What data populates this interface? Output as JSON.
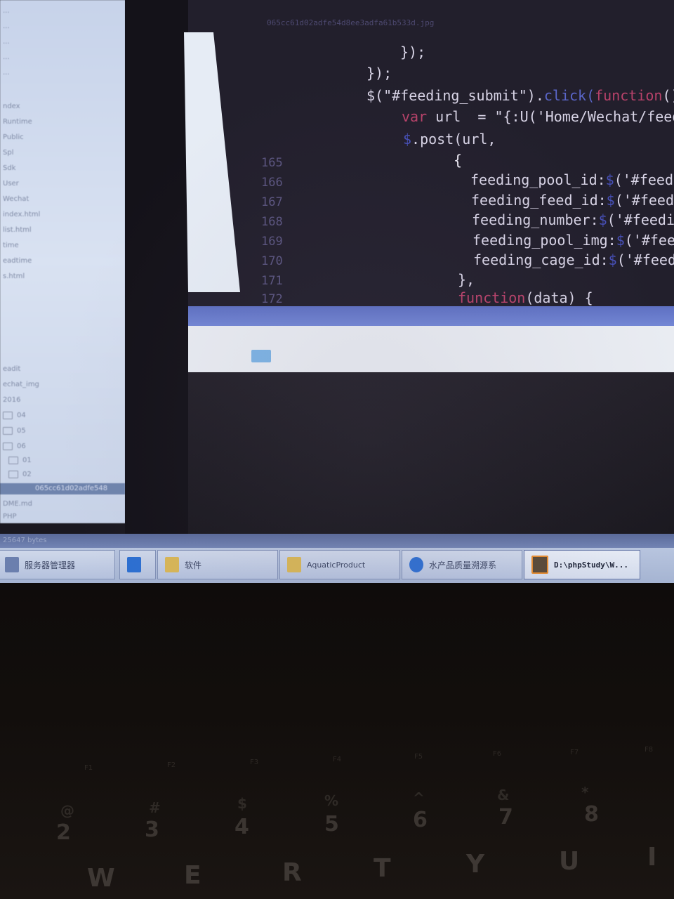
{
  "editor": {
    "tab_title": "065cc61d02adfe54d8ee3adfa61b533d.jpg",
    "gutter": [
      "165",
      "166",
      "167",
      "168",
      "169",
      "170",
      "171",
      "172"
    ],
    "lines": [
      {
        "text": "});"
      },
      {
        "text": "});"
      },
      {
        "prefix": "$(\"#feeding_submit\").",
        "call": "click",
        "open": "(",
        "kw": "function",
        "rest": "()"
      },
      {
        "kw": "var",
        "rest": " url  = \"{:U('Home/Wechat/feedi"
      },
      {
        "dollar": "$",
        "rest": ".post(url,"
      },
      {
        "text": "{"
      },
      {
        "key": "feeding_pool_id:",
        "dollar": "$",
        "rest": "('#feedi"
      },
      {
        "key": "feeding_feed_id:",
        "dollar": "$",
        "rest": "('#feedi"
      },
      {
        "key": "feeding_number:",
        "dollar": "$",
        "rest": "('#feeding"
      },
      {
        "key": "feeding_pool_img:",
        "dollar": "$",
        "rest": "('#feedi"
      },
      {
        "key": "feeding_cage_id:",
        "dollar": "$",
        "rest": "('#feedir"
      },
      {
        "text": "},"
      },
      {
        "kw": "function",
        "rest": "(data) {"
      }
    ]
  },
  "explorer": {
    "items": [
      "...",
      "...",
      "...",
      "...",
      "...",
      "ndex",
      "Runtime",
      "Public",
      "Spl",
      "Sdk",
      "User",
      "Wechat",
      "index.html",
      "list.html",
      "time",
      "eadtime",
      "s.html"
    ],
    "tree": [
      "eadit",
      "echat_img",
      "2016",
      "04",
      "05",
      "06",
      "01",
      "02"
    ],
    "selected_file": "065cc61d02adfe548",
    "bottom_items": [
      "DME.md",
      "PHP"
    ]
  },
  "status": {
    "text": "25647 bytes"
  },
  "taskbar": {
    "tasks": [
      {
        "label": "服务器管理器",
        "icon": "server-manager-icon"
      },
      {
        "label": "",
        "icon": "powershell-icon"
      },
      {
        "label": "软件",
        "icon": "folder-icon"
      },
      {
        "label": "AquaticProduct",
        "icon": "folder-icon"
      },
      {
        "label": "水产品质量溯源系",
        "icon": "sogou-icon"
      },
      {
        "label": "D:\\phpStudy\\W...",
        "icon": "sublime-icon"
      }
    ]
  },
  "keyboard": {
    "function_keys": [
      "F1",
      "F2",
      "F3",
      "F4",
      "F5",
      "F6",
      "F7",
      "F8"
    ],
    "number_keys": [
      "2",
      "3",
      "4",
      "5",
      "6",
      "7",
      "8"
    ],
    "symbol_keys": [
      "@",
      "#",
      "$",
      "%",
      "^",
      "&",
      "*"
    ],
    "letter_keys": [
      "W",
      "E",
      "R",
      "T",
      "Y",
      "U",
      "I"
    ]
  },
  "colors": {
    "editor_bg": "#221f2c",
    "keyword": "#b8426a",
    "function_call": "#5a66c9",
    "taskbar": "#b8c5df",
    "selection_bar": "#6a7cd0"
  }
}
